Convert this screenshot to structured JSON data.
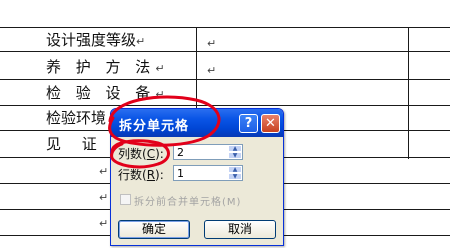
{
  "table": {
    "rows": [
      {
        "label": "设计强度等级",
        "mark_left": "↵",
        "mark_right": "↵"
      },
      {
        "label": "养 护 方 法",
        "mark_left": "↵",
        "mark_right": "↵"
      },
      {
        "label": "检 验 设 备",
        "mark_left": "↵",
        "mark_right": ""
      },
      {
        "label": "检验环境",
        "mark_left": "",
        "mark_right": ""
      },
      {
        "label": "见 证 单",
        "mark_left": "",
        "mark_right": ""
      },
      {
        "label": "",
        "mark_left": "↵",
        "mark_right": ""
      },
      {
        "label": "",
        "mark_left": "↵",
        "mark_right": ""
      },
      {
        "label": "",
        "mark_left": "↵",
        "mark_right": ""
      }
    ]
  },
  "dialog": {
    "title": "拆分单元格",
    "help_glyph": "?",
    "close_glyph": "✕",
    "columns_label": "列数",
    "columns_hotkey": "C",
    "columns_suffix": ":",
    "columns_value": "2",
    "rows_label": "行数",
    "rows_hotkey": "R",
    "rows_suffix": ":",
    "rows_value": "1",
    "merge_before_split_label": "拆分前合并单元格(M)",
    "merge_before_split_checked": false,
    "ok_label": "确定",
    "cancel_label": "取消"
  },
  "colors": {
    "annotation": "#e2001a",
    "titlebar": "#0046d5",
    "dialog_bg": "#ece9d8"
  }
}
